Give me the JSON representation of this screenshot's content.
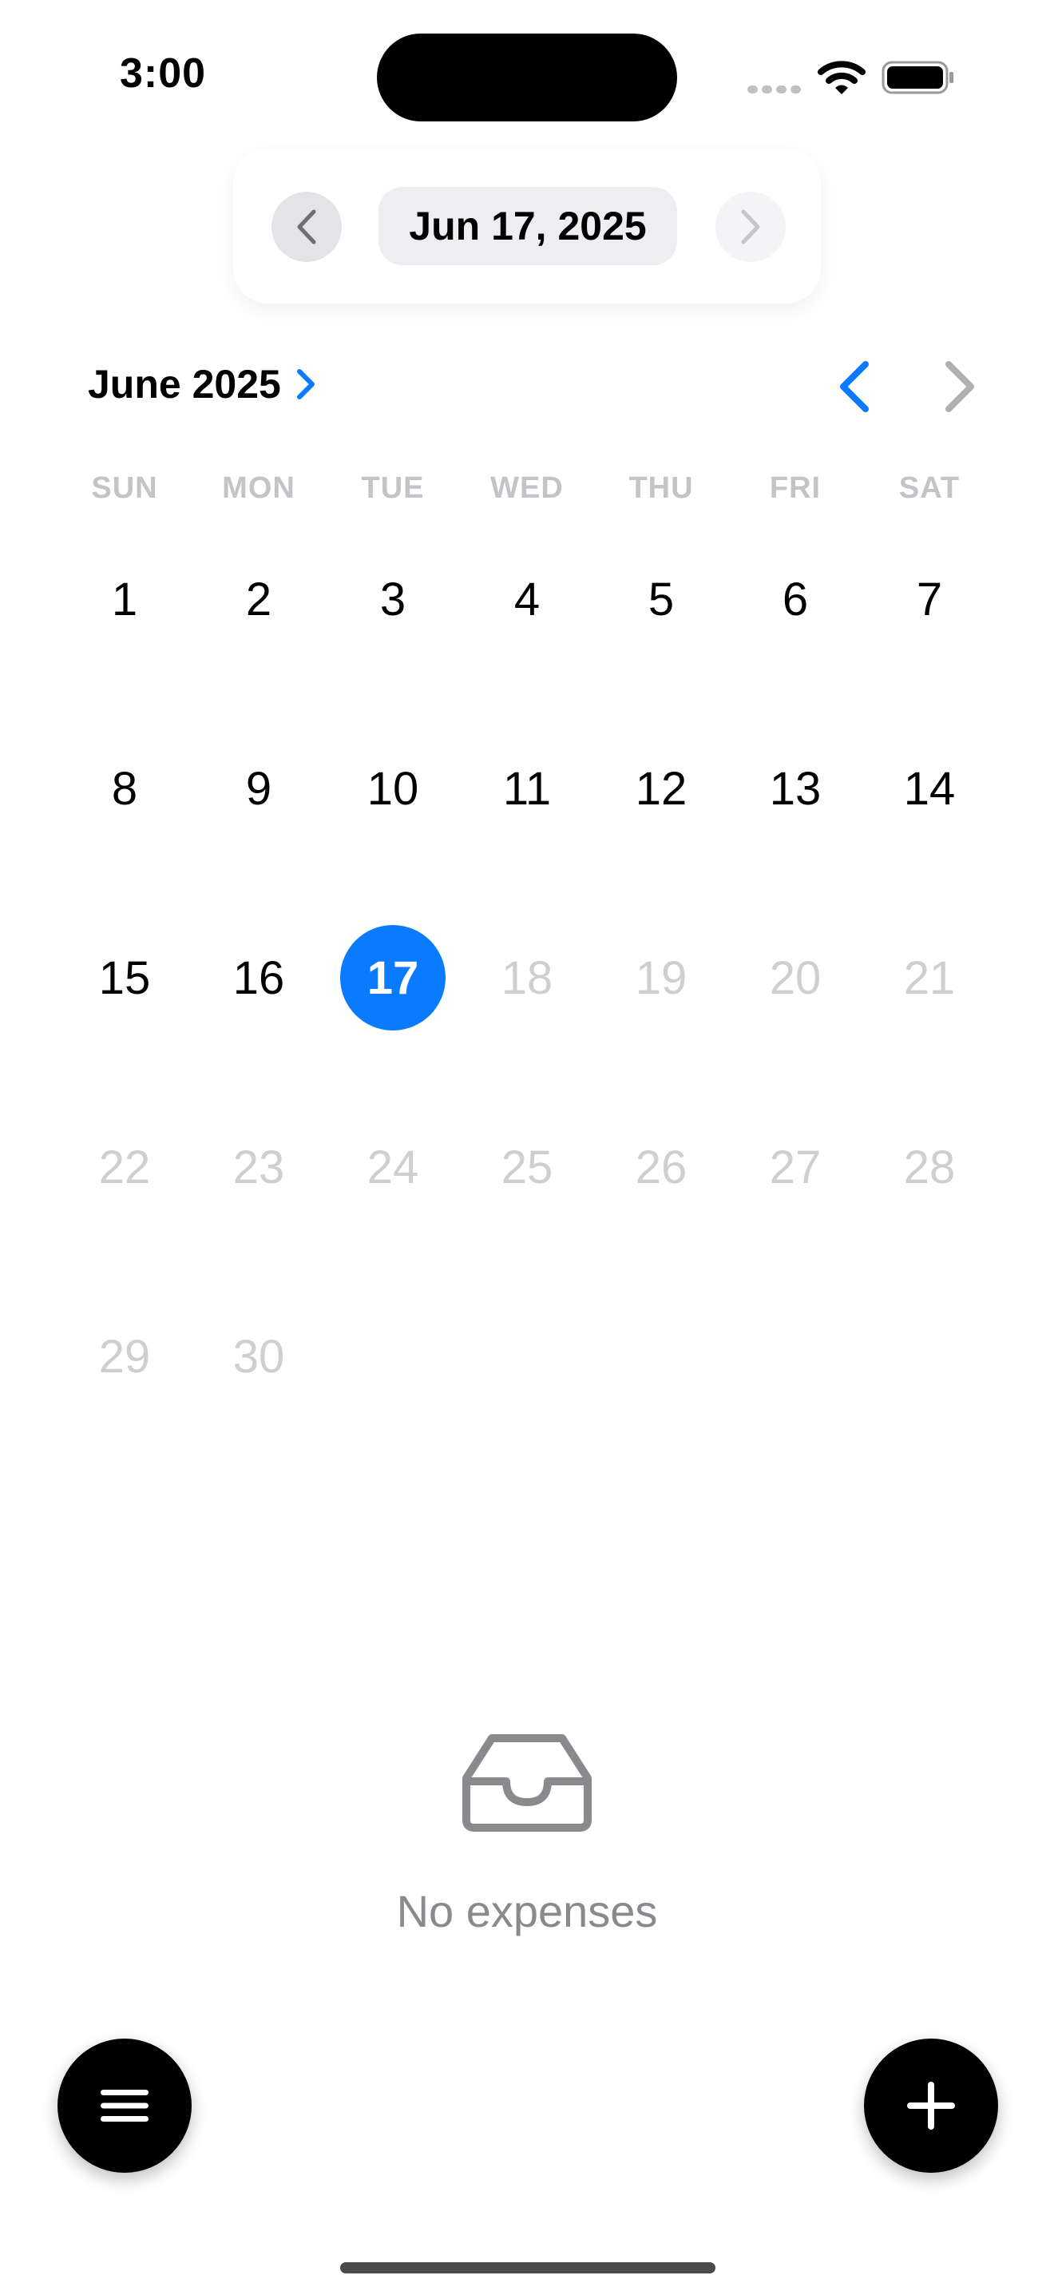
{
  "status_bar": {
    "time": "3:00"
  },
  "date_header": {
    "selected_date": "Jun 17, 2025"
  },
  "calendar": {
    "month_label": "June 2025",
    "weekdays": [
      "SUN",
      "MON",
      "TUE",
      "WED",
      "THU",
      "FRI",
      "SAT"
    ],
    "days": [
      "1",
      "2",
      "3",
      "4",
      "5",
      "6",
      "7",
      "8",
      "9",
      "10",
      "11",
      "12",
      "13",
      "14",
      "15",
      "16",
      "17",
      "18",
      "19",
      "20",
      "21",
      "22",
      "23",
      "24",
      "25",
      "26",
      "27",
      "28",
      "29",
      "30"
    ],
    "selected_day": "17",
    "accent_color": "#0a7bff"
  },
  "empty_state": {
    "message": "No expenses",
    "icon": "tray-icon"
  },
  "fab": {
    "menu_icon": "menu-icon",
    "add_icon": "plus-icon"
  }
}
